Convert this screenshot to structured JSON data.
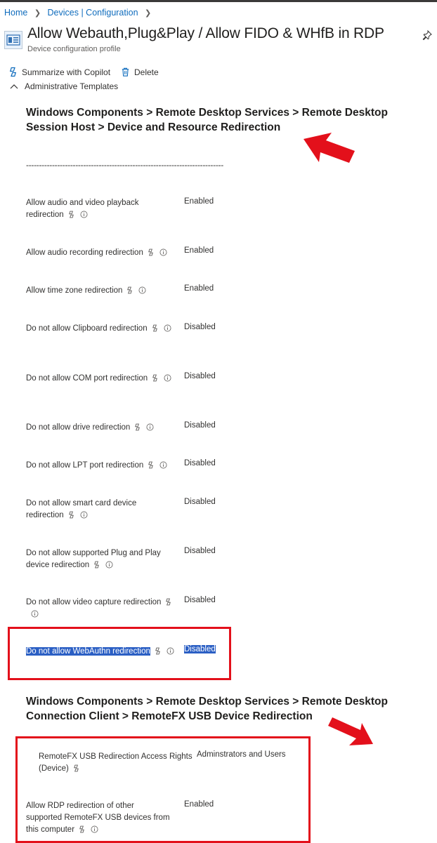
{
  "breadcrumb": {
    "items": [
      "Home",
      "Devices | Configuration"
    ]
  },
  "header": {
    "title": "Allow Webauth,Plug&Play / Allow FIDO & WHfB in RDP",
    "subtitle": "Device configuration profile"
  },
  "toolbar": {
    "copilot_label": "Summarize with Copilot",
    "delete_label": "Delete"
  },
  "section": {
    "label": "Administrative Templates"
  },
  "group1": {
    "heading": "Windows Components > Remote Desktop Services > Remote Desktop Session Host > Device and Resource Redirection",
    "divider": "----------------------------------------------------------------------------",
    "settings": [
      {
        "label": "Allow audio and video playback redirection",
        "value": "Enabled"
      },
      {
        "label": "Allow audio recording redirection",
        "value": "Enabled"
      },
      {
        "label": "Allow time zone redirection",
        "value": "Enabled"
      },
      {
        "label": "Do not allow Clipboard redirection",
        "value": "Disabled"
      },
      {
        "label": "Do not allow COM port redirection",
        "value": "Disabled"
      },
      {
        "label": "Do not allow drive redirection",
        "value": "Disabled"
      },
      {
        "label": "Do not allow LPT port redirection",
        "value": "Disabled"
      },
      {
        "label": "Do not allow smart card device redirection",
        "value": "Disabled"
      },
      {
        "label": "Do not allow supported Plug and Play device redirection",
        "value": "Disabled"
      },
      {
        "label": "Do not allow video capture redirection",
        "value": "Disabled"
      },
      {
        "label": "Do not allow WebAuthn redirection",
        "value": "Disabled"
      }
    ]
  },
  "group2": {
    "heading": "Windows Components > Remote Desktop Services > Remote Desktop Connection Client > RemoteFX USB Device Redirection",
    "settings": [
      {
        "label": "RemoteFX USB Redirection Access Rights (Device)",
        "value": "Adminstrators and Users"
      },
      {
        "label": "Allow RDP redirection of other supported RemoteFX USB devices from this computer",
        "value": "Enabled"
      }
    ]
  },
  "colors": {
    "link": "#0f6cbd",
    "annotation_red": "#e3101b",
    "selection": "#2b5fc4"
  }
}
